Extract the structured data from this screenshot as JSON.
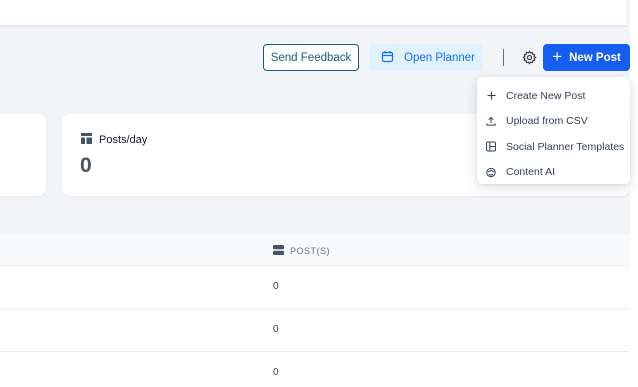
{
  "toolbar": {
    "send_feedback_label": "Send Feedback",
    "open_planner_label": "Open Planner",
    "new_post_label": "New Post"
  },
  "new_post_menu": {
    "items": [
      {
        "label": "Create New Post",
        "icon": "plus-icon"
      },
      {
        "label": "Upload from CSV",
        "icon": "upload-icon"
      },
      {
        "label": "Social Planner Templates",
        "icon": "template-icon"
      },
      {
        "label": "Content AI",
        "icon": "ai-icon"
      }
    ]
  },
  "stats": {
    "posts_per_day": {
      "label": "Posts/day",
      "value": "0",
      "icon": "layout-icon"
    }
  },
  "table": {
    "columns": [
      {
        "label": "POST(S)",
        "icon": "database-icon"
      }
    ],
    "rows": [
      {
        "posts": "0"
      },
      {
        "posts": "0"
      },
      {
        "posts": "0"
      }
    ]
  },
  "colors": {
    "primary": "#155eef",
    "feedback_border": "#155e75",
    "planner_bg": "#e0f2fe",
    "page_bg": "#f2f4f7"
  }
}
